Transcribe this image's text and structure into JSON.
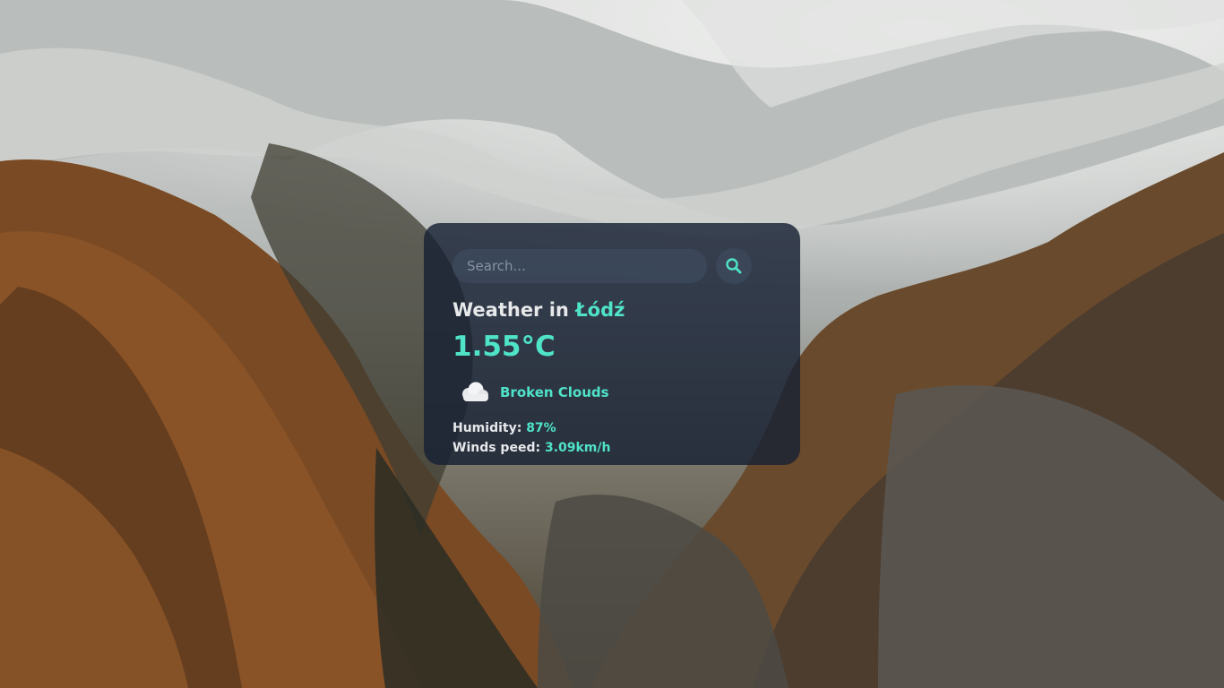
{
  "search": {
    "placeholder": "Search...",
    "button_icon": "search-icon"
  },
  "weather": {
    "title_prefix": "Weather in ",
    "city": "Łódź",
    "temperature": "1.55°C",
    "condition_icon": "cloud-icon",
    "condition": "Broken Clouds",
    "humidity_label": "Humidity:",
    "humidity_value": "87%",
    "wind_label": "Winds peed:",
    "wind_value": "3.09km/h"
  },
  "colors": {
    "accent": "#4fe3c8",
    "card_background": "#172133",
    "text": "#e6e8ea"
  }
}
